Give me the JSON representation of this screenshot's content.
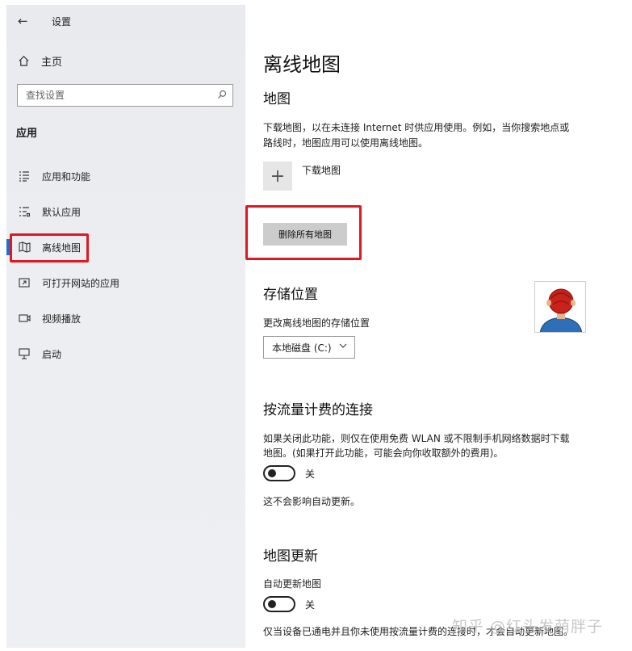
{
  "window": {
    "back_icon": "arrow-left-icon",
    "title": "设置"
  },
  "sidebar": {
    "home_label": "主页",
    "search_placeholder": "查找设置",
    "section_heading": "应用",
    "items": [
      {
        "label": "应用和功能",
        "icon": "apps-list-icon"
      },
      {
        "label": "默认应用",
        "icon": "default-apps-icon"
      },
      {
        "label": "离线地图",
        "icon": "map-icon",
        "active": true
      },
      {
        "label": "可打开网站的应用",
        "icon": "website-apps-icon"
      },
      {
        "label": "视频播放",
        "icon": "video-icon"
      },
      {
        "label": "启动",
        "icon": "startup-icon"
      }
    ],
    "accent_color": "#1f6ed4",
    "highlight_color": "#e01824"
  },
  "main": {
    "title": "离线地图",
    "maps_heading": "地图",
    "maps_desc_line1": "下载地图，以在未连接 Internet 时供应用使用。例如，当你搜索地点或",
    "maps_desc_line2": "路线时，地图应用可以使用离线地图。",
    "download_label": "下载地图",
    "delete_button": "删除所有地图",
    "storage_heading": "存储位置",
    "storage_label": "更改离线地图的存储位置",
    "storage_value": "本地磁盘 (C:)",
    "metered_heading": "按流量计费的连接",
    "metered_desc_line1": "如果关闭此功能，则仅在使用免费 WLAN 或不限制手机网络数据时下载",
    "metered_desc_line2": "地图。(如果打开此功能，可能会向你收取额外的费用)。",
    "metered_toggle_state": "关",
    "metered_note": "这不会影响自动更新。",
    "update_heading": "地图更新",
    "update_label": "自动更新地图",
    "update_toggle_state": "关",
    "update_note": "仅当设备已通电并且你未使用按流量计费的连接时，才会自动更新地图。"
  },
  "watermark": "知乎 @红头发萌胖子"
}
